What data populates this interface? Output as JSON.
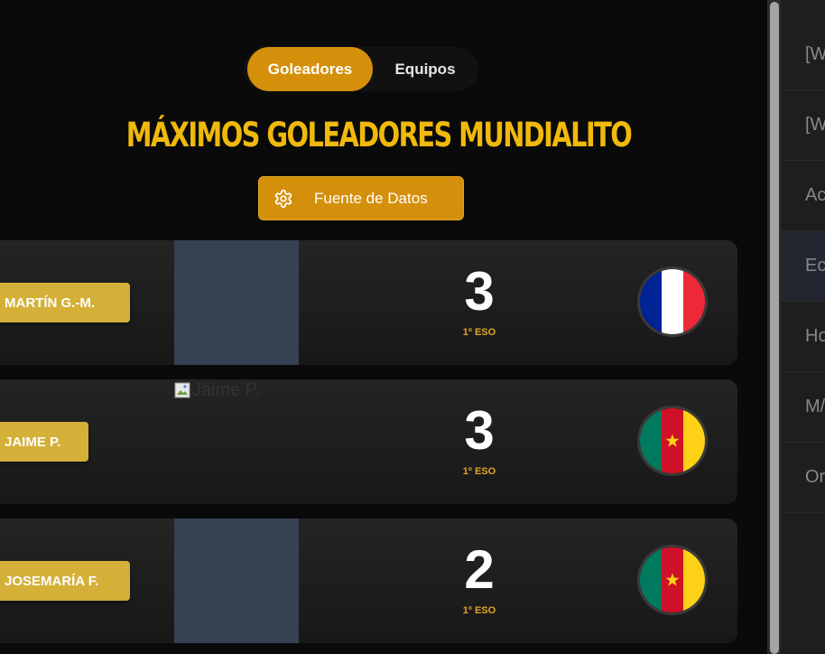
{
  "tabs": [
    {
      "label": "Goleadores",
      "active": true
    },
    {
      "label": "Equipos",
      "active": false
    }
  ],
  "title": "MÁXIMOS GOLEADORES MUNDIALITO",
  "source_button": {
    "label": "Fuente de Datos",
    "icon": "gear-icon"
  },
  "players": [
    {
      "name": "MARTÍN G.-M.",
      "goals": "3",
      "grade": "1º ESO",
      "flag": "france",
      "photo": "placeholder"
    },
    {
      "name": "JAIME P.",
      "goals": "3",
      "grade": "1º ESO",
      "flag": "cameroon",
      "photo_alt": "Jaime P."
    },
    {
      "name": "JOSEMARÍA F.",
      "goals": "2",
      "grade": "1º ESO",
      "flag": "cameroon",
      "photo": "placeholder"
    }
  ],
  "side_items": [
    "[W",
    "[W",
    "Ac",
    "Ec",
    "Ho",
    "M/",
    "Or"
  ],
  "colors": {
    "accent": "#d4900a",
    "title": "#f0b90b",
    "name_tag": "#d4b038",
    "card": "#1e1e1e"
  }
}
